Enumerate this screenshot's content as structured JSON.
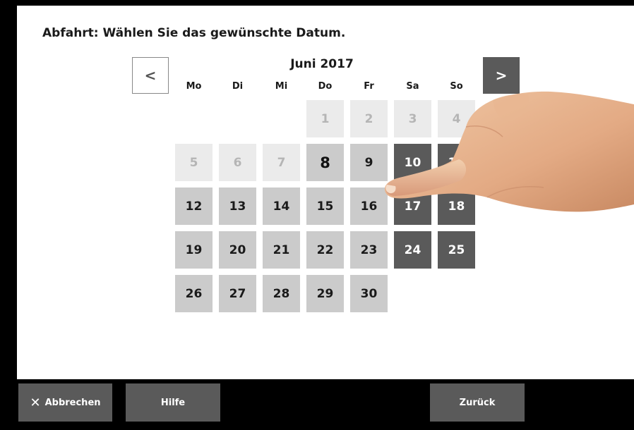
{
  "header": {
    "title": "Abfahrt: Wählen Sie das gewünschte Datum."
  },
  "calendar": {
    "month_title": "Juni 2017",
    "prev_icon": "<",
    "next_icon": ">",
    "weekdays": [
      "Mo",
      "Di",
      "Mi",
      "Do",
      "Fr",
      "Sa",
      "So"
    ],
    "days": [
      {
        "label": "1",
        "state": "disabled"
      },
      {
        "label": "2",
        "state": "disabled"
      },
      {
        "label": "3",
        "state": "disabled"
      },
      {
        "label": "4",
        "state": "disabled"
      },
      {
        "label": "5",
        "state": "disabled"
      },
      {
        "label": "6",
        "state": "disabled"
      },
      {
        "label": "7",
        "state": "disabled"
      },
      {
        "label": "8",
        "state": "today"
      },
      {
        "label": "9",
        "state": "normal"
      },
      {
        "label": "10",
        "state": "weekend"
      },
      {
        "label": "11",
        "state": "weekend"
      },
      {
        "label": "12",
        "state": "normal"
      },
      {
        "label": "13",
        "state": "normal"
      },
      {
        "label": "14",
        "state": "normal"
      },
      {
        "label": "15",
        "state": "normal"
      },
      {
        "label": "16",
        "state": "normal"
      },
      {
        "label": "17",
        "state": "weekend"
      },
      {
        "label": "18",
        "state": "weekend"
      },
      {
        "label": "19",
        "state": "normal"
      },
      {
        "label": "20",
        "state": "normal"
      },
      {
        "label": "21",
        "state": "normal"
      },
      {
        "label": "22",
        "state": "normal"
      },
      {
        "label": "23",
        "state": "normal"
      },
      {
        "label": "24",
        "state": "weekend"
      },
      {
        "label": "25",
        "state": "weekend"
      },
      {
        "label": "26",
        "state": "normal"
      },
      {
        "label": "27",
        "state": "normal"
      },
      {
        "label": "28",
        "state": "normal"
      },
      {
        "label": "29",
        "state": "normal"
      },
      {
        "label": "30",
        "state": "normal"
      }
    ]
  },
  "footer": {
    "cancel_icon": "✕",
    "cancel_label": "Abbrechen",
    "help_label": "Hilfe",
    "back_label": "Zurück"
  },
  "colors": {
    "background": "#000000",
    "screen": "#ffffff",
    "button": "#5a5a5a",
    "day_normal": "#cbcbcb",
    "day_disabled": "#ebebeb",
    "day_weekend": "#5a5a5a"
  }
}
